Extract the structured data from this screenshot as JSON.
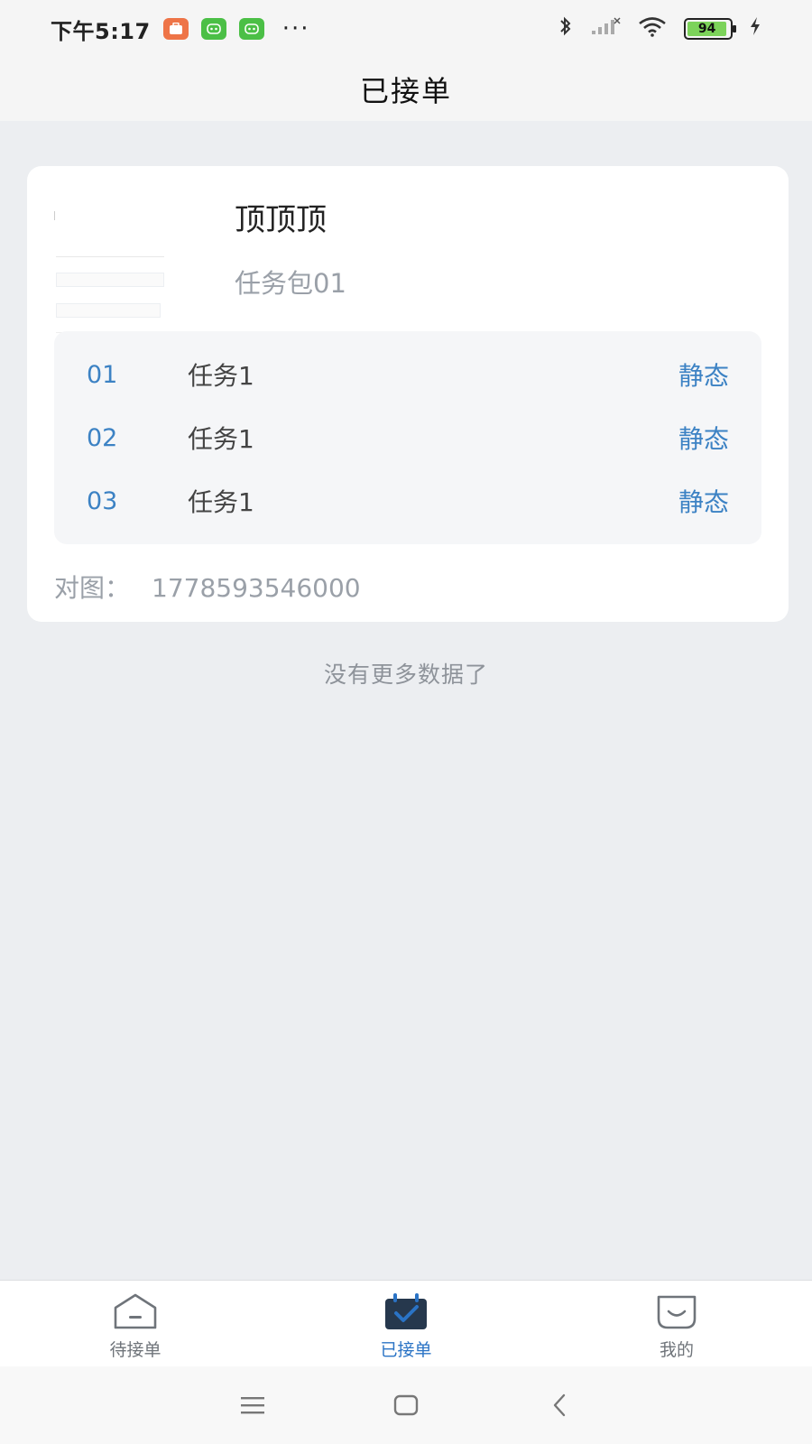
{
  "status_bar": {
    "time": "下午5:17",
    "battery_level": "94",
    "battery_fraction": 0.94,
    "more": "···"
  },
  "header": {
    "title": "已接单"
  },
  "package": {
    "title": "顶顶顶",
    "subtitle": "任务包01",
    "tasks": [
      {
        "no": "01",
        "name": "任务1",
        "status": "静态"
      },
      {
        "no": "02",
        "name": "任务1",
        "status": "静态"
      },
      {
        "no": "03",
        "name": "任务1",
        "status": "静态"
      }
    ],
    "footer_label": "对图：",
    "footer_value": "1778593546000"
  },
  "list_end": "没有更多数据了",
  "tabs": [
    {
      "label": "待接单",
      "icon": "inbox-icon",
      "active": false
    },
    {
      "label": "已接单",
      "icon": "calendar-check-icon",
      "active": true
    },
    {
      "label": "我的",
      "icon": "smile-face-icon",
      "active": false
    }
  ],
  "colors": {
    "accent": "#2a73c5",
    "task_blue": "#3c82c4",
    "background": "#eceef1"
  }
}
